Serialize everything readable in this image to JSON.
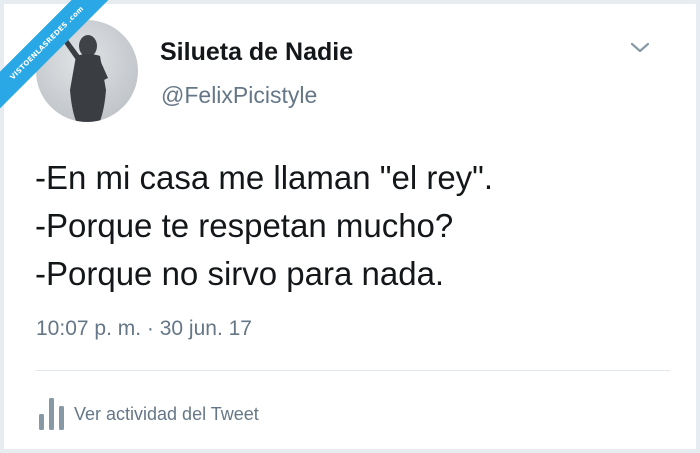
{
  "watermark": {
    "text": "VISTOENLASREDES .com",
    "color": "#2aa8e6"
  },
  "tweet": {
    "avatar_icon": "profile-silhouette",
    "display_name": "Silueta de Nadie",
    "handle": "@FelixPicistyle",
    "menu_icon": "chevron-down-icon",
    "lines": [
      "-En mi casa me llaman \"el rey\".",
      "-Porque te respetan mucho?",
      "-Porque no sirvo para nada."
    ],
    "timestamp": "10:07 p. m. · 30 jun. 17",
    "activity_icon": "bar-chart-icon",
    "activity_label": "Ver actividad del Tweet"
  },
  "colors": {
    "text_primary": "#14171a",
    "text_secondary": "#657786",
    "divider": "#e1e8ed",
    "background": "#e6ecf0"
  }
}
